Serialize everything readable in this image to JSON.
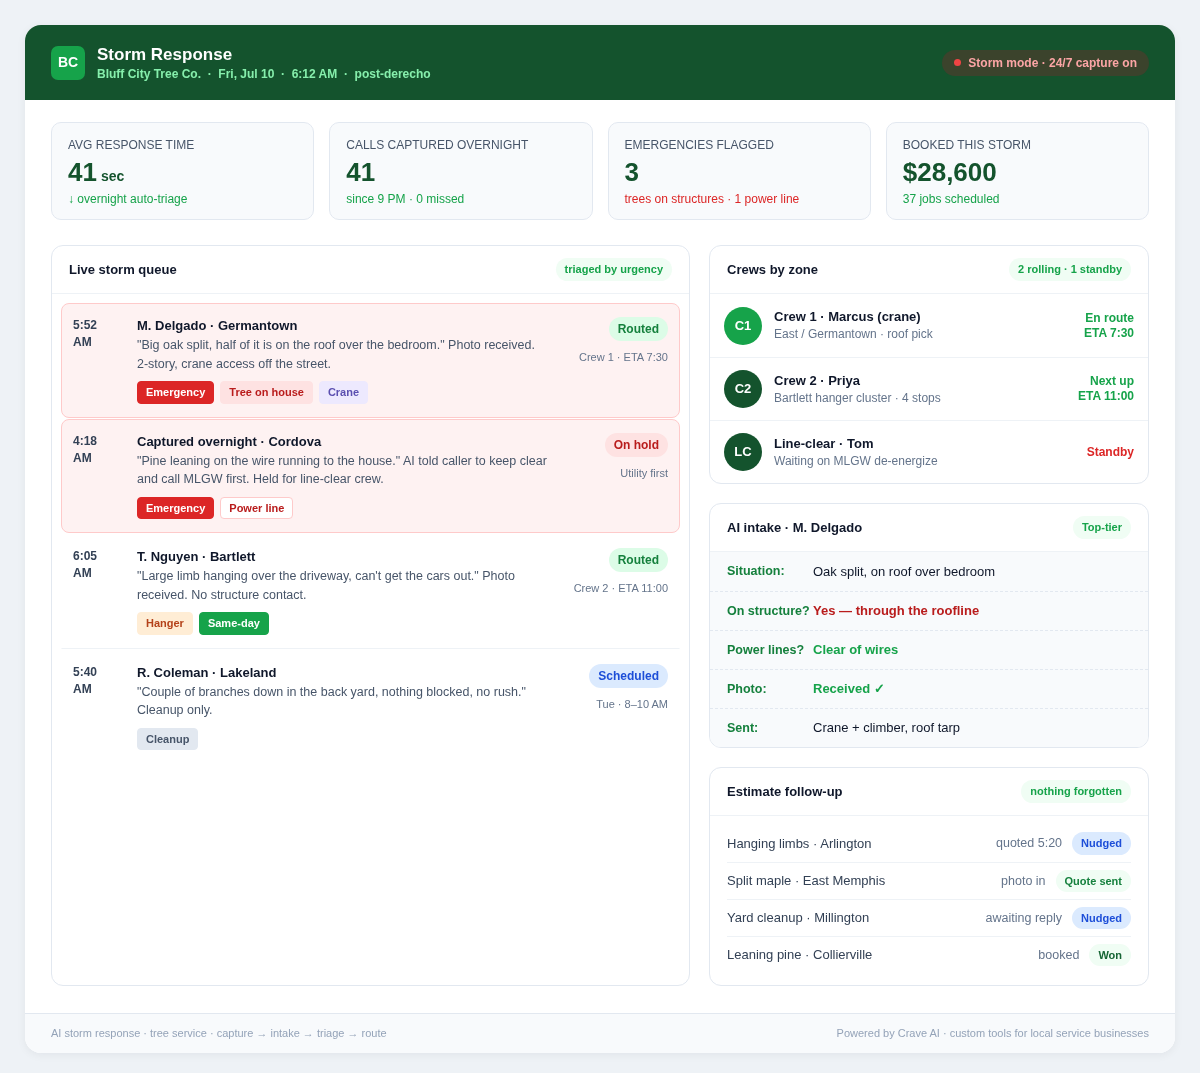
{
  "header": {
    "logo": "BC",
    "title": "Storm Response",
    "subtitle": "Bluff City Tree Co.  ·  Fri, Jul 10  ·  6:12 AM  ·  post-derecho",
    "mode_pill": "Storm mode · 24/7 capture on"
  },
  "kpis": [
    {
      "label": "AVG RESPONSE TIME",
      "value": "41",
      "unit": "sec",
      "note": {
        "text": "↓ overnight auto-triage",
        "kind": "good"
      }
    },
    {
      "label": "CALLS CAPTURED OVERNIGHT",
      "value": "41",
      "note": {
        "text": "since 9 PM · 0 missed",
        "kind": "good"
      }
    },
    {
      "label": "EMERGENCIES FLAGGED",
      "value": "3",
      "note": {
        "text": "trees on structures · 1 power line",
        "kind": "alert"
      }
    },
    {
      "label": "BOOKED THIS STORM",
      "value": "$28,600",
      "note": {
        "text": "37 jobs scheduled",
        "kind": "good"
      }
    }
  ],
  "queue": {
    "title": "Live storm queue",
    "badge": "triaged by urgency",
    "items": [
      {
        "time": "5:52 AM",
        "title": "M. Delgado · Germantown",
        "quote": "\"Big oak split, half of it is on the roof over the bedroom.\" Photo received. 2-story, crane access off the street.",
        "status": {
          "text": "Routed",
          "kind": "routed"
        },
        "detail": "Crew 1 · ETA 7:30",
        "tags": [
          {
            "text": "Emergency",
            "kind": "emergency"
          },
          {
            "text": "Tree on house",
            "kind": "structure"
          },
          {
            "text": "Crane",
            "kind": "equipment"
          }
        ],
        "emergency": true
      },
      {
        "time": "4:18 AM",
        "title": "Captured overnight · Cordova",
        "quote": "\"Pine leaning on the wire running to the house.\" AI told caller to keep clear and call MLGW first. Held for line-clear crew.",
        "status": {
          "text": "On hold",
          "kind": "hold"
        },
        "detail": "Utility first",
        "tags": [
          {
            "text": "Emergency",
            "kind": "emergency"
          },
          {
            "text": "Power line",
            "kind": "hazard"
          }
        ],
        "emergency": true
      },
      {
        "time": "6:05 AM",
        "title": "T. Nguyen · Bartlett",
        "quote": "\"Large limb hanging over the driveway, can't get the cars out.\" Photo received. No structure contact.",
        "status": {
          "text": "Routed",
          "kind": "routed"
        },
        "detail": "Crew 2 · ETA 11:00",
        "tags": [
          {
            "text": "Hanger",
            "kind": "hanger"
          },
          {
            "text": "Same-day",
            "kind": "sameday"
          }
        ],
        "emergency": false
      },
      {
        "time": "5:40 AM",
        "title": "R. Coleman · Lakeland",
        "quote": "\"Couple of branches down in the back yard, nothing blocked, no rush.\" Cleanup only.",
        "status": {
          "text": "Scheduled",
          "kind": "scheduled"
        },
        "detail": "Tue · 8–10 AM",
        "tags": [
          {
            "text": "Cleanup",
            "kind": "cleanup"
          }
        ],
        "emergency": false
      }
    ]
  },
  "crews": {
    "title": "Crews by zone",
    "badge": "2 rolling · 1 standby",
    "rows": [
      {
        "initials": "C1",
        "color": "#16a34a",
        "name": "Crew 1 · Marcus (crane)",
        "detail": "East / Germantown · roof pick",
        "status": "En route",
        "eta": "ETA 7:30",
        "kind": "rolling"
      },
      {
        "initials": "C2",
        "color": "#14532d",
        "name": "Crew 2 · Priya",
        "detail": "Bartlett hanger cluster · 4 stops",
        "status": "Next up",
        "eta": "ETA 11:00",
        "kind": "rolling"
      },
      {
        "initials": "LC",
        "color": "#14532d",
        "name": "Line-clear · Tom",
        "detail": "Waiting on MLGW de-energize",
        "status": "Standby",
        "kind": "standby"
      }
    ]
  },
  "intake": {
    "title": "AI intake · M. Delgado",
    "badge": "Top-tier",
    "rows": [
      {
        "label": "Situation:",
        "value": "Oak split, on roof over bedroom",
        "kind": "plain"
      },
      {
        "label": "On structure?",
        "value": "Yes — through the roofline",
        "kind": "alert"
      },
      {
        "label": "Power lines?",
        "value": "Clear of wires",
        "kind": "ok"
      },
      {
        "label": "Photo:",
        "value": "Received ✓",
        "kind": "ok"
      },
      {
        "label": "Sent:",
        "value": "Crane + climber, roof tarp",
        "kind": "plain"
      }
    ]
  },
  "followup": {
    "title": "Estimate follow-up",
    "badge": "nothing forgotten",
    "rows": [
      {
        "job": "Hanging limbs · Arlington",
        "note": "quoted 5:20",
        "status": {
          "text": "Nudged",
          "kind": "nudged"
        }
      },
      {
        "job": "Split maple · East Memphis",
        "note": "photo in",
        "status": {
          "text": "Quote sent",
          "kind": "sent"
        }
      },
      {
        "job": "Yard cleanup · Millington",
        "note": "awaiting reply",
        "status": {
          "text": "Nudged",
          "kind": "nudged"
        }
      },
      {
        "job": "Leaning pine · Collierville",
        "note": "booked",
        "status": {
          "text": "Won",
          "kind": "won"
        }
      }
    ]
  },
  "footer": {
    "left": "AI storm response · tree service · capture → intake → triage → route",
    "right": "Powered by Crave AI · custom tools for local service businesses"
  }
}
